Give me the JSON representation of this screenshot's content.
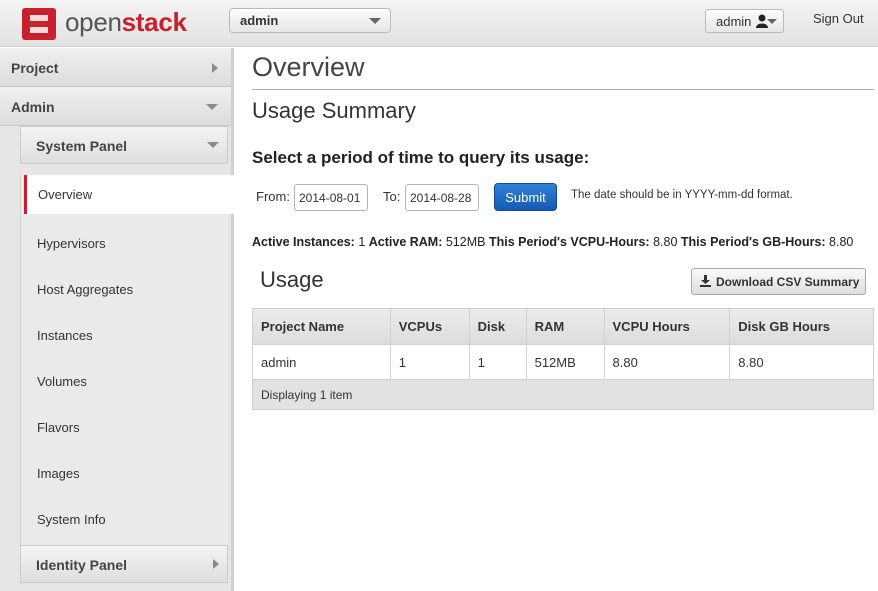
{
  "header": {
    "brand_prefix": "open",
    "brand_suffix": "stack",
    "project_select_value": "admin",
    "user_label": "admin",
    "sign_out_label": "Sign Out",
    "brand_color": "#c8202e"
  },
  "sidebar": {
    "project_label": "Project",
    "admin_label": "Admin",
    "system_panel_label": "System Panel",
    "identity_panel_label": "Identity Panel",
    "items": [
      {
        "label": "Overview",
        "active": true
      },
      {
        "label": "Hypervisors"
      },
      {
        "label": "Host Aggregates"
      },
      {
        "label": "Instances"
      },
      {
        "label": "Volumes"
      },
      {
        "label": "Flavors"
      },
      {
        "label": "Images"
      },
      {
        "label": "System Info"
      }
    ]
  },
  "main": {
    "page_title": "Overview",
    "usage_summary_title": "Usage Summary",
    "query_heading": "Select a period of time to query its usage:",
    "from_label": "From:",
    "from_value": "2014-08-01",
    "to_label": "To:",
    "to_value": "2014-08-28",
    "submit_label": "Submit",
    "date_hint": "The date should be in YYYY-mm-dd format.",
    "stats": {
      "active_instances_label": "Active Instances:",
      "active_instances_value": "1",
      "active_ram_label": "Active RAM:",
      "active_ram_value": "512MB",
      "vcpu_hours_label": "This Period's VCPU-Hours:",
      "vcpu_hours_value": "8.80",
      "gb_hours_label": "This Period's GB-Hours:",
      "gb_hours_value": "8.80"
    },
    "usage_title": "Usage",
    "download_csv_label": "Download CSV Summary",
    "table": {
      "columns": [
        "Project Name",
        "VCPUs",
        "Disk",
        "RAM",
        "VCPU Hours",
        "Disk GB Hours"
      ],
      "rows": [
        [
          "admin",
          "1",
          "1",
          "512MB",
          "8.80",
          "8.80"
        ]
      ],
      "footer": "Displaying 1 item"
    }
  }
}
